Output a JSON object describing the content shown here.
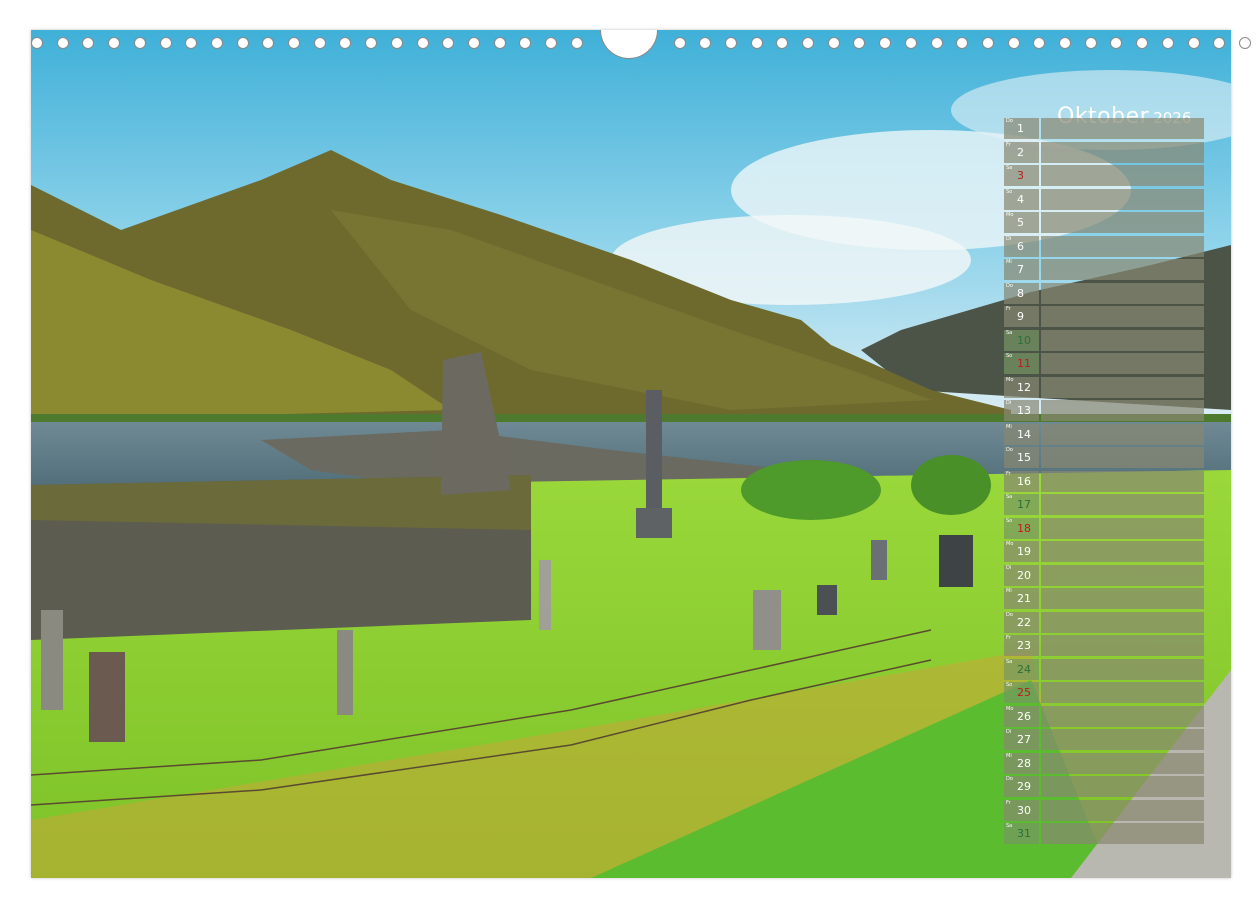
{
  "calendar": {
    "month": "Oktober",
    "year": "2026",
    "days": [
      {
        "d": "1",
        "wd": "Do",
        "type": "weekday"
      },
      {
        "d": "2",
        "wd": "Fr",
        "type": "weekday"
      },
      {
        "d": "3",
        "wd": "Sa",
        "type": "hol"
      },
      {
        "d": "4",
        "wd": "So",
        "type": "weekday"
      },
      {
        "d": "5",
        "wd": "Mo",
        "type": "weekday"
      },
      {
        "d": "6",
        "wd": "Di",
        "type": "weekday"
      },
      {
        "d": "7",
        "wd": "Mi",
        "type": "weekday"
      },
      {
        "d": "8",
        "wd": "Do",
        "type": "weekday"
      },
      {
        "d": "9",
        "wd": "Fr",
        "type": "weekday"
      },
      {
        "d": "10",
        "wd": "Sa",
        "type": "sat"
      },
      {
        "d": "11",
        "wd": "So",
        "type": "sun"
      },
      {
        "d": "12",
        "wd": "Mo",
        "type": "weekday"
      },
      {
        "d": "13",
        "wd": "Di",
        "type": "weekday"
      },
      {
        "d": "14",
        "wd": "Mi",
        "type": "weekday"
      },
      {
        "d": "15",
        "wd": "Do",
        "type": "weekday"
      },
      {
        "d": "16",
        "wd": "Fr",
        "type": "weekday"
      },
      {
        "d": "17",
        "wd": "Sa",
        "type": "sat"
      },
      {
        "d": "18",
        "wd": "So",
        "type": "sun"
      },
      {
        "d": "19",
        "wd": "Mo",
        "type": "weekday"
      },
      {
        "d": "20",
        "wd": "Di",
        "type": "weekday"
      },
      {
        "d": "21",
        "wd": "Mi",
        "type": "weekday"
      },
      {
        "d": "22",
        "wd": "Do",
        "type": "weekday"
      },
      {
        "d": "23",
        "wd": "Fr",
        "type": "weekday"
      },
      {
        "d": "24",
        "wd": "Sa",
        "type": "sat"
      },
      {
        "d": "25",
        "wd": "So",
        "type": "sun"
      },
      {
        "d": "26",
        "wd": "Mo",
        "type": "weekday"
      },
      {
        "d": "27",
        "wd": "Di",
        "type": "weekday"
      },
      {
        "d": "28",
        "wd": "Mi",
        "type": "weekday"
      },
      {
        "d": "29",
        "wd": "Do",
        "type": "weekday"
      },
      {
        "d": "30",
        "wd": "Fr",
        "type": "weekday"
      },
      {
        "d": "31",
        "wd": "Sa",
        "type": "sat"
      }
    ]
  },
  "colors": {
    "sky": "#7cc4dc",
    "grass": "#8fd43a",
    "mountain": "#6e6a2e",
    "loch": "#5b7a86",
    "stone_wall": "#6b6a5c",
    "cell": "#888870",
    "sunday_text": "#b81e1e",
    "saturday_text": "#2e6e38"
  }
}
